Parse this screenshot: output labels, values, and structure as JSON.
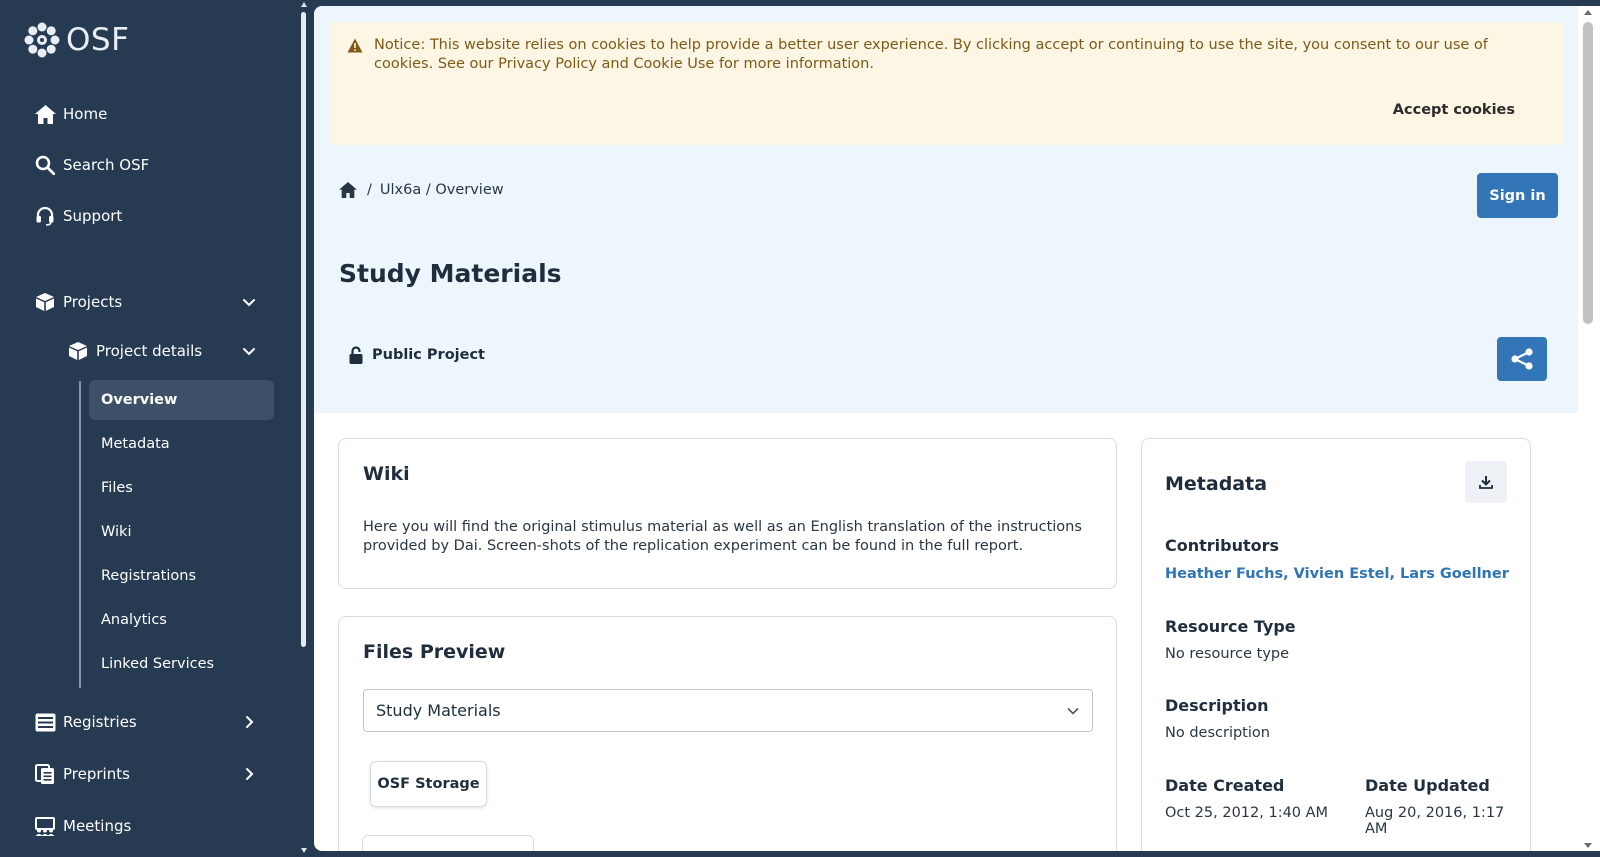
{
  "brand": {
    "name": "OSF"
  },
  "sidebar": {
    "items": [
      {
        "label": "Home",
        "icon": "home-icon"
      },
      {
        "label": "Search OSF",
        "icon": "search-icon"
      },
      {
        "label": "Support",
        "icon": "headset-icon"
      },
      {
        "label": "Projects",
        "icon": "cube-icon"
      },
      {
        "label": "Project details",
        "icon": "cube-icon"
      },
      {
        "label": "Registries",
        "icon": "registries-icon"
      },
      {
        "label": "Preprints",
        "icon": "preprints-icon"
      },
      {
        "label": "Meetings",
        "icon": "meetings-icon"
      }
    ],
    "project_links": [
      "Overview",
      "Metadata",
      "Files",
      "Wiki",
      "Registrations",
      "Analytics",
      "Linked Services"
    ],
    "active": "Overview"
  },
  "notice": {
    "text": "Notice: This website relies on cookies to help provide a better user experience. By clicking accept or continuing to use the site, you consent to our use of cookies. See our Privacy Policy and Cookie Use for more information.",
    "accept_label": "Accept cookies"
  },
  "breadcrumb": {
    "sep": "/",
    "path": "Ulx6a / Overview"
  },
  "header": {
    "signin_label": "Sign in",
    "title": "Study Materials",
    "visibility": "Public Project"
  },
  "wiki": {
    "title": "Wiki",
    "text": "Here you will find the original stimulus material as well as an English translation of the instructions provided by Dai. Screen-shots of the replication experiment can be found in the full report."
  },
  "files": {
    "title": "Files Preview",
    "selected": "Study Materials",
    "storage_label": "OSF Storage"
  },
  "metadata": {
    "title": "Metadata",
    "contributors_label": "Contributors",
    "contributors": "Heather Fuchs, Vivien Estel, Lars Goellner",
    "resource_type_label": "Resource Type",
    "resource_type": "No resource type",
    "description_label": "Description",
    "description": "No description",
    "date_created_label": "Date Created",
    "date_created": "Oct 25, 2012, 1:40 AM",
    "date_updated_label": "Date Updated",
    "date_updated": "Aug 20, 2016, 1:17 AM"
  },
  "colors": {
    "sidebar_bg": "#263a52",
    "accent": "#3276b7",
    "notice_bg": "#fdf6e4",
    "notice_text": "#7d5a17",
    "hero_bg": "#edf5fd",
    "link": "#2f74b5"
  }
}
